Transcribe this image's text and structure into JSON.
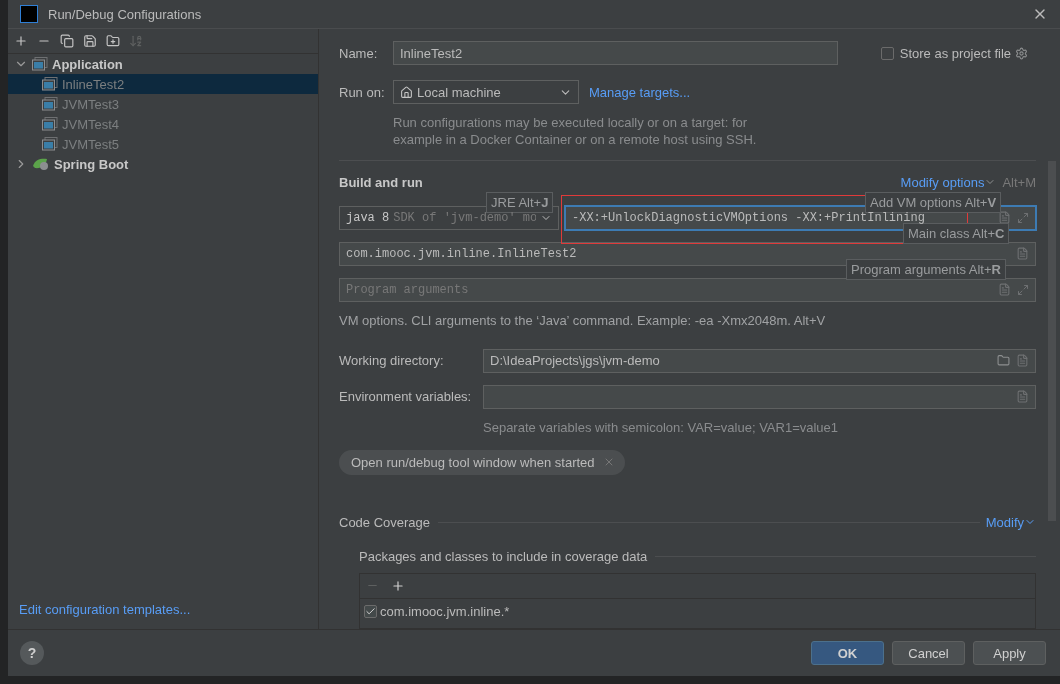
{
  "window": {
    "title": "Run/Debug Configurations"
  },
  "toolbar": [
    {
      "kind": "add",
      "disabled": false
    },
    {
      "kind": "remove",
      "disabled": false
    },
    {
      "kind": "copy",
      "disabled": false
    },
    {
      "kind": "save",
      "disabled": false
    },
    {
      "kind": "folder",
      "disabled": false
    },
    {
      "kind": "sort",
      "disabled": true
    }
  ],
  "tree": [
    {
      "label": "Application",
      "kind": "app",
      "expanded": true,
      "selected": false,
      "children": [
        {
          "label": "InlineTest2",
          "kind": "app",
          "selected": true
        },
        {
          "label": "JVMTest3",
          "kind": "app",
          "selected": false
        },
        {
          "label": "JVMTest4",
          "kind": "app",
          "selected": false
        },
        {
          "label": "JVMTest5",
          "kind": "app",
          "selected": false
        }
      ]
    },
    {
      "label": "Spring Boot",
      "kind": "spring",
      "expanded": false,
      "selected": false
    }
  ],
  "edit_templates_link": "Edit configuration templates...",
  "name": {
    "label": "Name:",
    "value": "InlineTest2"
  },
  "store_as_project_file": {
    "label": "Store as project file",
    "checked": false
  },
  "run_on": {
    "label": "Run on:",
    "value": "Local machine",
    "link": "Manage targets...",
    "hint": "Run configurations may be executed locally or on a target: for example in a Docker Container or on a remote host using SSH."
  },
  "build_and_run": {
    "title": "Build and run",
    "modify_link": "Modify options",
    "modify_shortcut": "Alt+M",
    "jre": {
      "value": "java 8",
      "detail": "SDK of 'jvm-demo' mo"
    },
    "vm_options": {
      "value": "-XX:+UnlockDiagnosticVMOptions -XX:+PrintInlining",
      "focused": true
    },
    "main_class": {
      "value": "com.imooc.jvm.inline.InlineTest2"
    },
    "program_arguments": {
      "placeholder": "Program arguments"
    },
    "help": "VM options. CLI arguments to the ‘Java’ command. Example: -ea -Xmx2048m. Alt+V",
    "shortcut_hints": [
      {
        "kind": "jre",
        "text": "JRE Alt+**J**"
      },
      {
        "kind": "vm",
        "text": "Add VM options Alt+**V**"
      },
      {
        "kind": "main",
        "text": "Main class Alt+**C**"
      },
      {
        "kind": "args",
        "text": "Program arguments Alt+**R**"
      }
    ]
  },
  "working_directory": {
    "label": "Working directory:",
    "value": "D:\\IdeaProjects\\jgs\\jvm-demo"
  },
  "environment_variables": {
    "label": "Environment variables:",
    "hint": "Separate variables with semicolon: VAR=value; VAR1=value1"
  },
  "option_tag": {
    "label": "Open run/debug tool window when started"
  },
  "code_coverage": {
    "title": "Code Coverage",
    "modify_link": "Modify",
    "packages_title": "Packages and classes to include in coverage data",
    "packages": [
      {
        "label": "com.imooc.jvm.inline.*",
        "checked": true
      }
    ]
  },
  "help_button": "?",
  "buttons": [
    {
      "label": "OK",
      "kind": "primary"
    },
    {
      "label": "Cancel",
      "kind": "normal"
    },
    {
      "label": "Apply",
      "kind": "normal"
    }
  ]
}
